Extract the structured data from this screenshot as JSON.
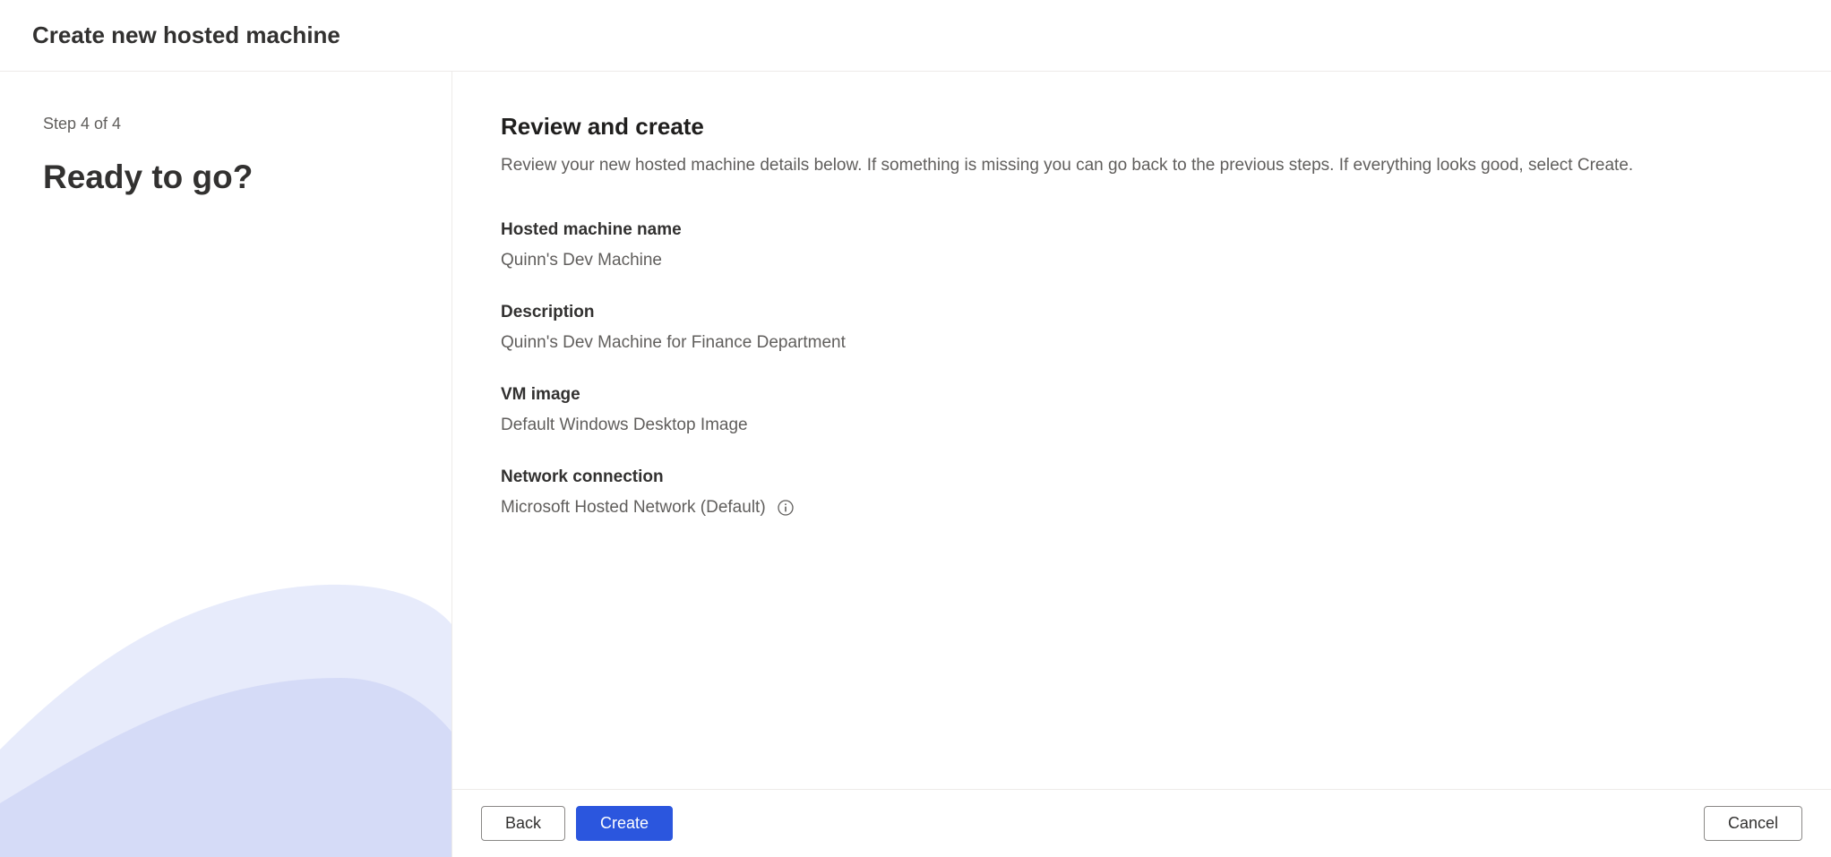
{
  "header": {
    "title": "Create new hosted machine"
  },
  "sidebar": {
    "step_indicator": "Step 4 of 4",
    "title": "Ready to go?"
  },
  "main": {
    "title": "Review and create",
    "description": "Review your new hosted machine details below. If something is missing you can go back to the previous steps. If everything looks good, select Create.",
    "fields": {
      "machine_name": {
        "label": "Hosted machine name",
        "value": "Quinn's Dev Machine"
      },
      "description": {
        "label": "Description",
        "value": "Quinn's Dev Machine for Finance Department"
      },
      "vm_image": {
        "label": "VM image",
        "value": "Default Windows Desktop Image"
      },
      "network": {
        "label": "Network connection",
        "value": "Microsoft Hosted Network (Default)"
      }
    }
  },
  "footer": {
    "back_label": "Back",
    "create_label": "Create",
    "cancel_label": "Cancel"
  }
}
